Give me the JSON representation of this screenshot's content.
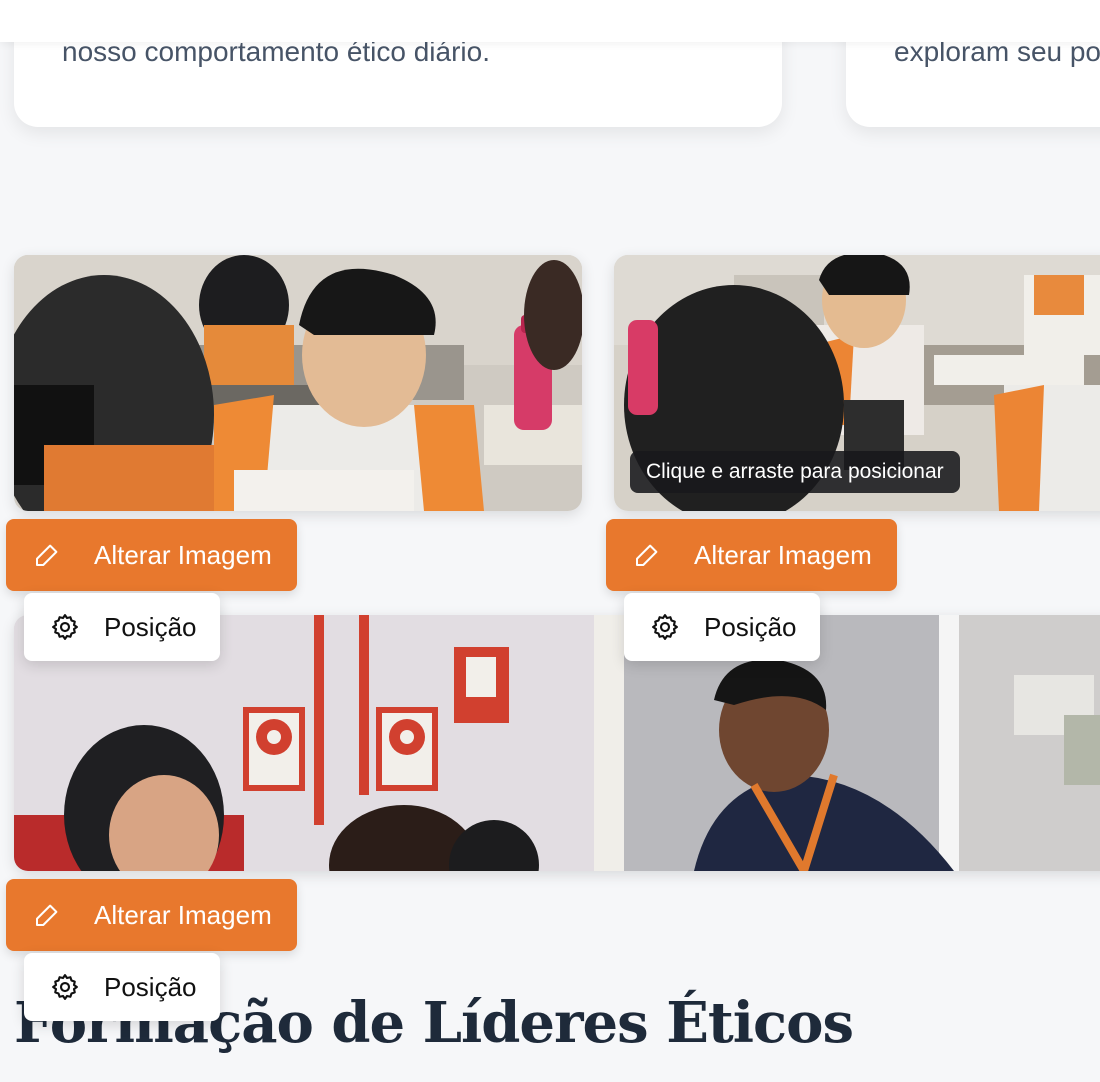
{
  "cards": [
    {
      "text": "nosso comportamento ético diário."
    },
    {
      "text": "exploram seu po"
    }
  ],
  "images": [
    {
      "alt": "Aluno em sala de aula com garrafa rosa"
    },
    {
      "alt": "Aluno olhando para a câmera em sala de aula"
    },
    {
      "alt": "Professor conversando com alunos"
    }
  ],
  "tooltip": {
    "text": "Clique e arraste para posicionar"
  },
  "actions": {
    "change_label": "Alterar Imagem",
    "position_label": "Posição"
  },
  "section": {
    "title": "Formação de Líderes Éticos"
  },
  "colors": {
    "accent": "#e8782d",
    "heading": "#1e2a3a",
    "background": "#f6f7f9"
  },
  "icons": {
    "change": "pencil-icon",
    "position": "gear-icon"
  }
}
